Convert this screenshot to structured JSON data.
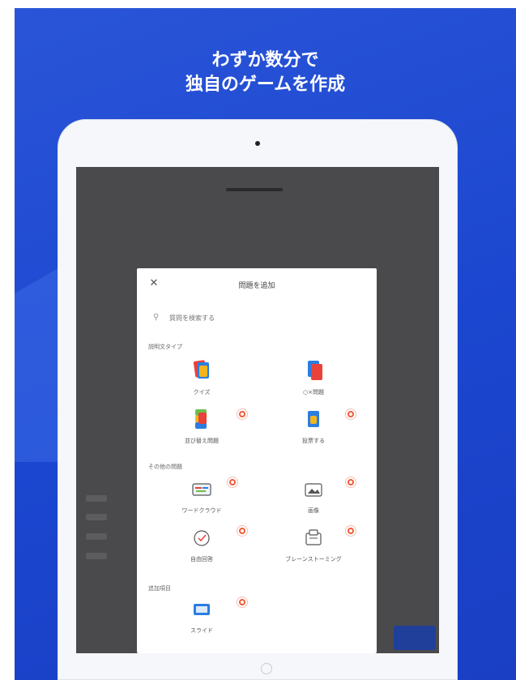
{
  "banner": {
    "headline_line1": "わずか数分で",
    "headline_line2": "独自のゲームを作成"
  },
  "modal": {
    "title": "問題を追加",
    "search": {
      "placeholder": "質問を検索する"
    },
    "sections": [
      {
        "label": "説明文タイプ"
      },
      {
        "label": "その他の問題"
      },
      {
        "label": "追加項目"
      }
    ],
    "tiles": [
      {
        "label": "クイズ",
        "badge": false
      },
      {
        "label": "○×問題",
        "badge": false
      },
      {
        "label": "並び替え問題",
        "badge": true
      },
      {
        "label": "投票する",
        "badge": true
      },
      {
        "label": "ワードクラウド",
        "badge": true
      },
      {
        "label": "画像",
        "badge": true
      },
      {
        "label": "自由回答",
        "badge": true
      },
      {
        "label": "ブレーンストーミング",
        "badge": true
      },
      {
        "label": "スライド",
        "badge": true
      }
    ]
  },
  "colors": {
    "banner_blue": "#1b46cf",
    "badge": "#f15a3a",
    "screen_gray": "#4a4a4c"
  }
}
